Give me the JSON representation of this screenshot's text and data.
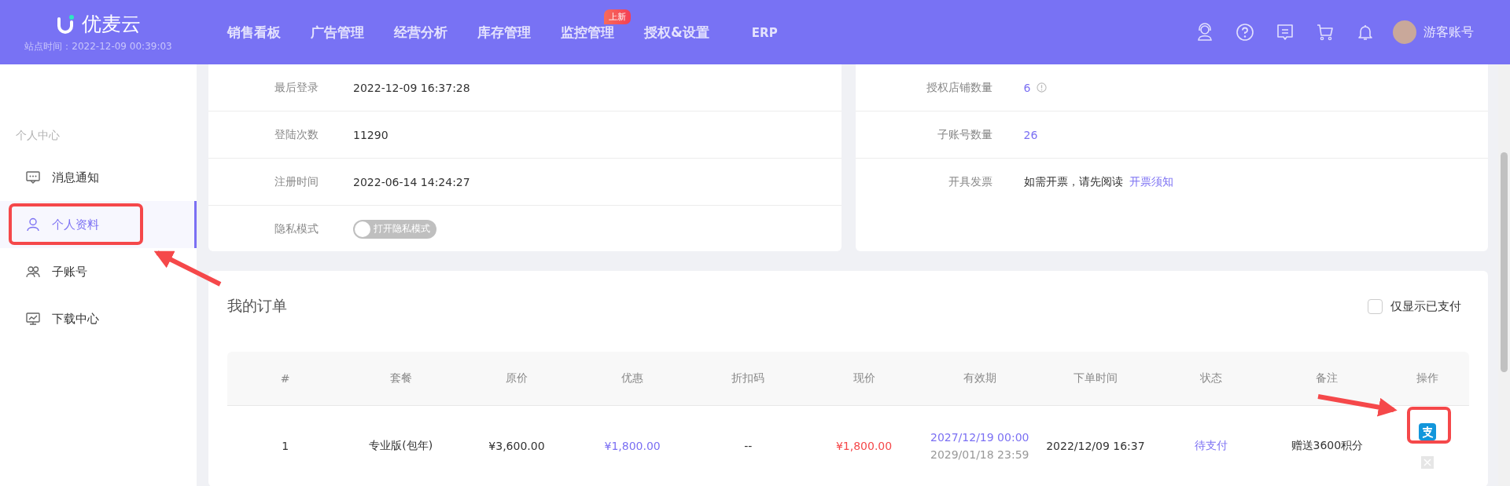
{
  "header": {
    "logo": "优麦云",
    "site_time": "站点时间：2022-12-09 00:39:03",
    "nav": [
      {
        "label": "销售看板"
      },
      {
        "label": "广告管理"
      },
      {
        "label": "经营分析"
      },
      {
        "label": "库存管理"
      },
      {
        "label": "监控管理",
        "badge": "上新"
      },
      {
        "label": "授权&设置"
      },
      {
        "label": "ERP"
      }
    ],
    "user": "游客账号"
  },
  "sidebar": {
    "section": "个人中心",
    "items": [
      {
        "label": "消息通知",
        "selected": false
      },
      {
        "label": "个人资料",
        "selected": true
      },
      {
        "label": "子账号",
        "selected": false
      },
      {
        "label": "下载中心",
        "selected": false
      }
    ]
  },
  "account_info": [
    {
      "kind": "text",
      "label": "最后登录",
      "value": "2022-12-09 16:37:28"
    },
    {
      "kind": "text",
      "label": "登陆次数",
      "value": "11290"
    },
    {
      "kind": "text",
      "label": "注册时间",
      "value": "2022-06-14 14:24:27"
    },
    {
      "kind": "toggle",
      "label": "隐私模式",
      "value": "打开隐私模式",
      "on": false
    }
  ],
  "authorization_info": [
    {
      "kind": "count_info",
      "label": "授权店铺数量",
      "value": "6"
    },
    {
      "kind": "count",
      "label": "子账号数量",
      "value": "26"
    },
    {
      "kind": "notice",
      "label": "开具发票",
      "value": "如需开票，请先阅读",
      "link": "开票须知"
    }
  ],
  "orders": {
    "title": "我的订单",
    "paid_only_filter": {
      "label": "仅显示已支付",
      "checked": false
    },
    "columns": [
      "#",
      "套餐",
      "原价",
      "优惠",
      "折扣码",
      "现价",
      "有效期",
      "下单时间",
      "状态",
      "备注",
      "操作"
    ],
    "rows": [
      {
        "index": "1",
        "plan": "专业版(包年)",
        "original_price": "¥3,600.00",
        "discount": "¥1,800.00",
        "discount_code": "--",
        "current_price": "¥1,800.00",
        "valid_from": "2027/12/19 00:00",
        "valid_to": "2029/01/18 23:59",
        "order_time": "2022/12/09 16:37",
        "status": "待支付",
        "note": "赠送3600积分"
      }
    ]
  }
}
